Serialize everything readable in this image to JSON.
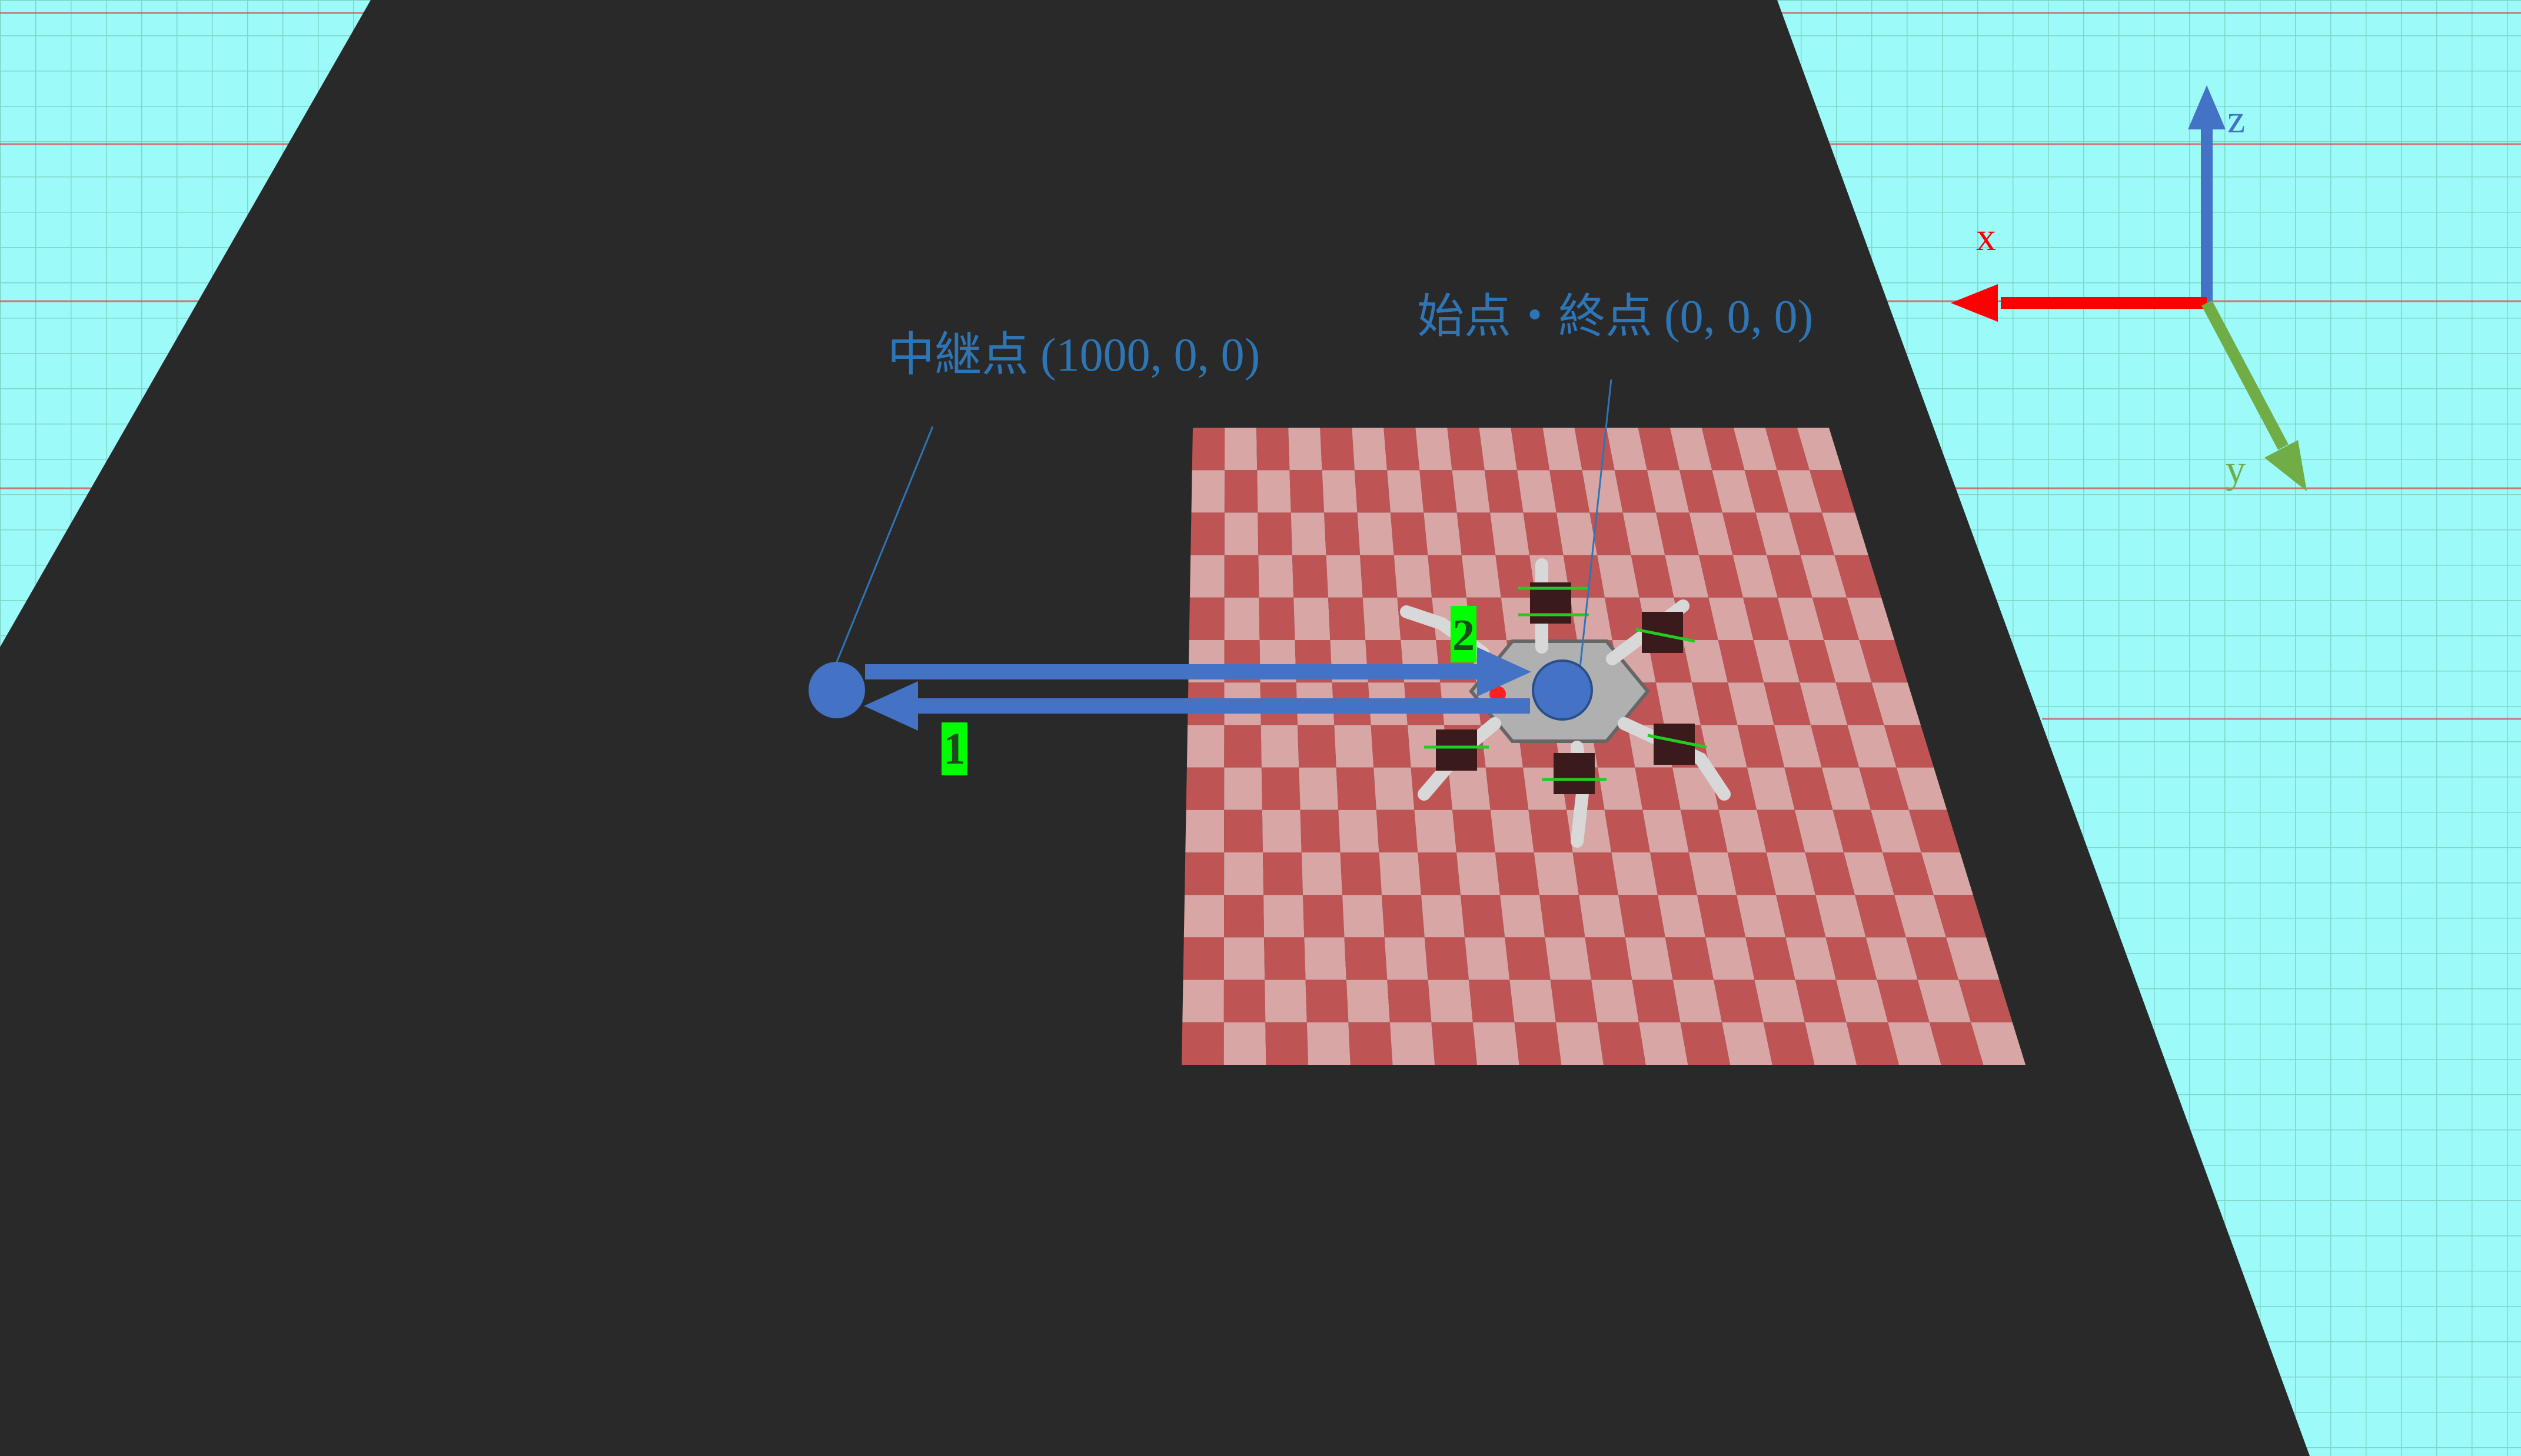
{
  "waypoint_relay": {
    "label": "中継点 (1000, 0, 0)"
  },
  "waypoint_start_end": {
    "label": "始点・終点 (0, 0, 0)"
  },
  "path_markers": {
    "outbound": "1",
    "return": "2"
  },
  "axes": {
    "x": "x",
    "y": "y",
    "z": "z"
  },
  "colors": {
    "sky_grid_bg": "#9cfaf9",
    "grid_line": "#7fd6c8",
    "grid_red": "#e04040",
    "ground": "#292929",
    "checker_dark": "#bf5454",
    "checker_light": "#d9a6a6",
    "path_blue": "#4472c4",
    "label_blue": "#2e75b6",
    "marker_green": "#00ff00",
    "axis_x": "#ff0000",
    "axis_y": "#70ad47",
    "axis_z": "#4472c4"
  }
}
